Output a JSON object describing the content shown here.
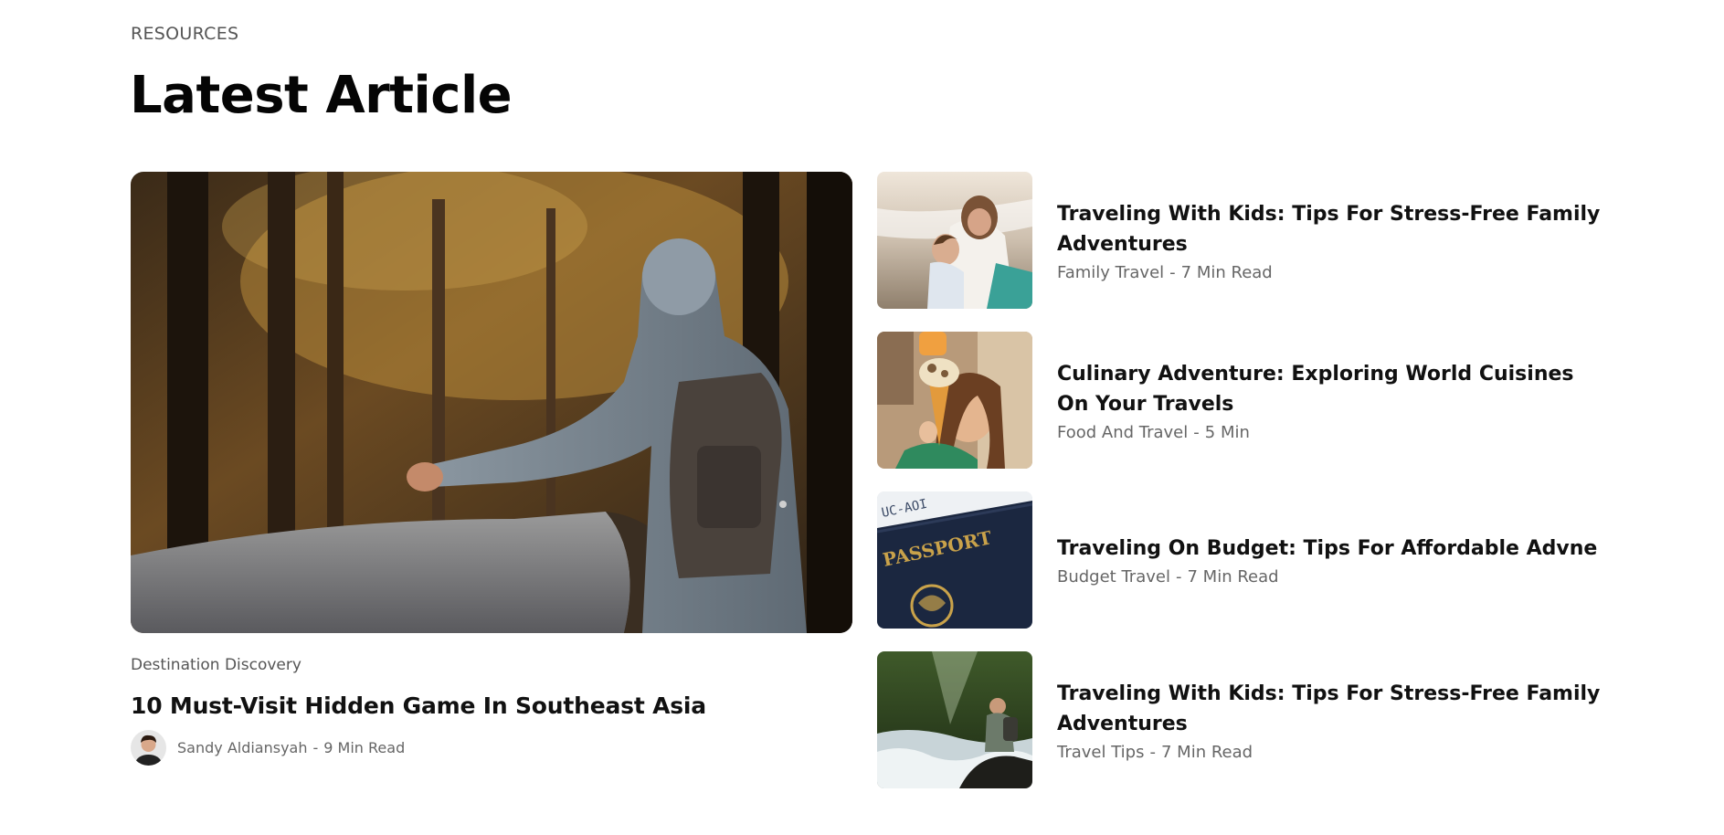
{
  "section": {
    "eyebrow": "RESOURCES",
    "title": "Latest Article"
  },
  "featured": {
    "category": "Destination Discovery",
    "title": "10 Must-Visit Hidden Game In Southeast Asia",
    "author": "Sandy Aldiansyah",
    "separator": "-",
    "read_time": "9 Min Read"
  },
  "articles": [
    {
      "title": "Traveling With Kids: Tips For Stress-Free Family Adventures",
      "category": "Family Travel",
      "separator": "-",
      "read_time": "7 Min Read"
    },
    {
      "title": "Culinary Adventure: Exploring World Cuisines On Your Travels",
      "category": "Food And Travel",
      "separator": "-",
      "read_time": "5 Min"
    },
    {
      "title": "Traveling On Budget: Tips For Affordable Advne",
      "category": "Budget Travel",
      "separator": "-",
      "read_time": "7 Min Read"
    },
    {
      "title": "Traveling With Kids: Tips For Stress-Free Family Adventures",
      "category": "Travel Tips",
      "separator": "-",
      "read_time": "7 Min Read"
    }
  ],
  "passport_text": "PASSPORT",
  "colors": {
    "text_primary": "#111111",
    "text_muted": "#666666",
    "background": "#ffffff"
  }
}
